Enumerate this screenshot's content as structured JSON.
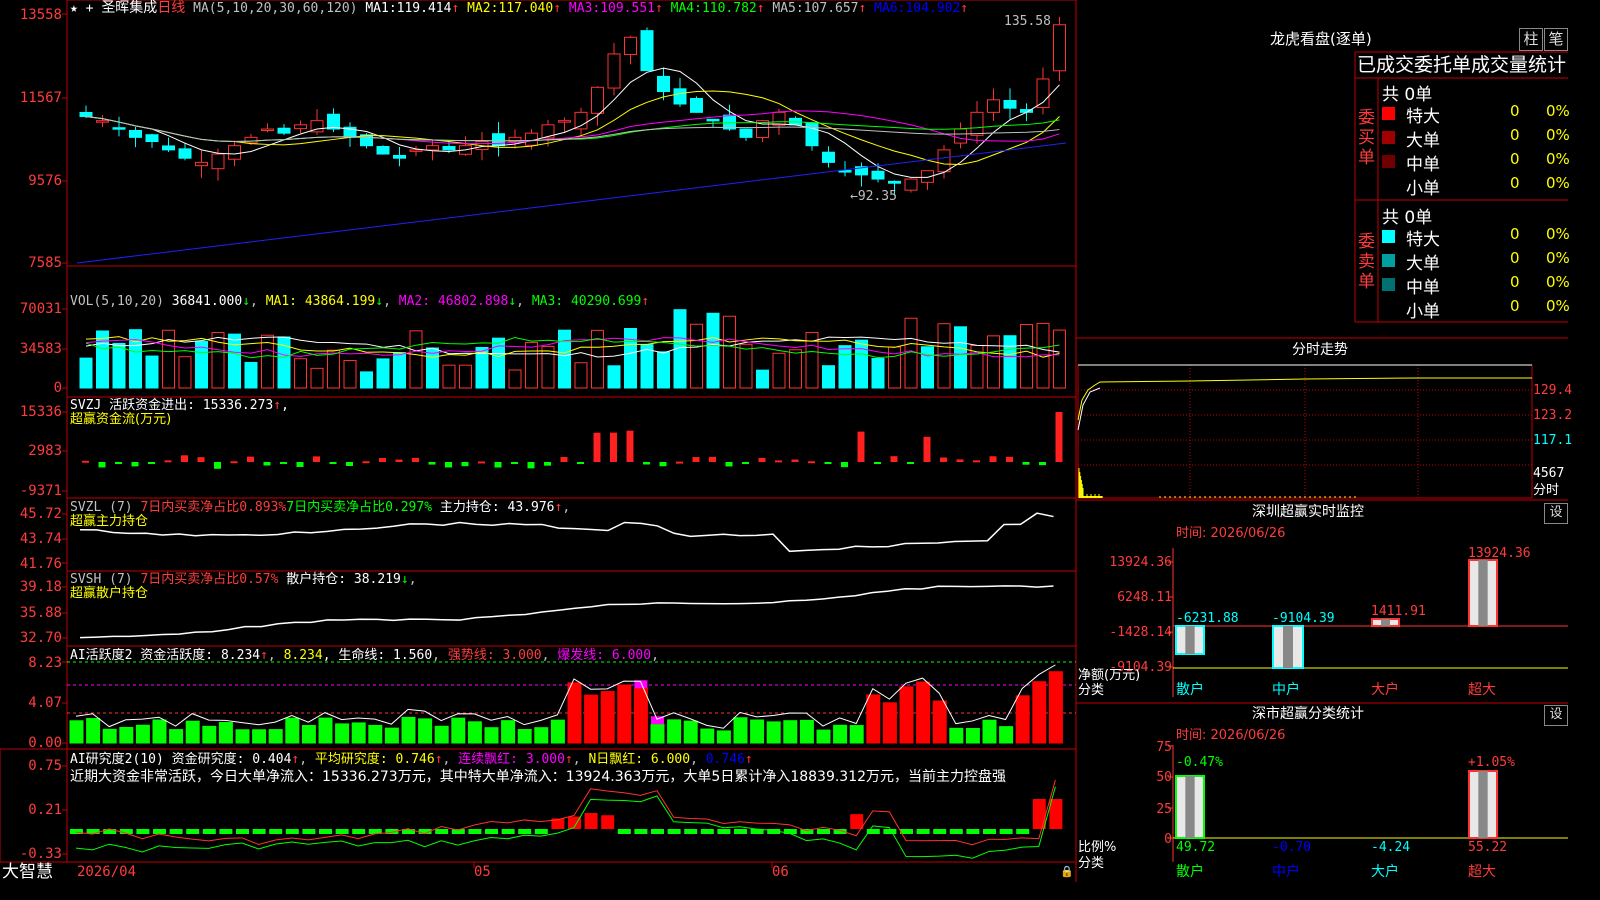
{
  "stock": {
    "name": "圣晖集成",
    "period": "日线",
    "ma_params": "MA(5,10,20,30,60,120)",
    "ma_values": [
      {
        "label": "MA1:",
        "value": "119.414",
        "color": "#ffffff"
      },
      {
        "label": "MA2:",
        "value": "117.040",
        "color": "#ffff00"
      },
      {
        "label": "MA3:",
        "value": "109.551",
        "color": "#ff00ff"
      },
      {
        "label": "MA4:",
        "value": "110.782",
        "color": "#00ff00"
      },
      {
        "label": "MA5:",
        "value": "107.657",
        "color": "#c0c0c0"
      },
      {
        "label": "MA6:",
        "value": "104.902",
        "color": "#0000ff"
      }
    ],
    "high_mark": "135.58",
    "low_mark": "92.35",
    "price_axis": [
      "13558",
      "11567",
      "9576",
      "7585"
    ]
  },
  "vol": {
    "header_params": "VOL(5,10,20)",
    "header_value": "36841.000",
    "ma1": "MA1: 43864.199",
    "ma2": "MA2: 46802.898",
    "ma3": "MA3: 40290.699",
    "axis": [
      "70031",
      "34583",
      "0"
    ]
  },
  "svzj": {
    "header": "SVZJ  活跃资金进出: 15336.273",
    "sub": "超赢资金流(万元)",
    "axis": [
      "15336",
      "2983",
      "-9371"
    ]
  },
  "svzl": {
    "p1": "SVZL (7)",
    "p2": "7日内买卖净占比0.893%",
    "p3": "7日内买卖净占比0.297%",
    "p4": "主力持仓: 43.976",
    "sub": "超赢主力持仓",
    "axis": [
      "45.72",
      "43.74",
      "41.76"
    ]
  },
  "svsh": {
    "p1": "SVSH (7)",
    "p2": "7日内买卖净占比0.57%",
    "p3": "散户持仓: 38.219",
    "sub": "超赢散户持仓",
    "axis": [
      "39.18",
      "35.88",
      "32.70"
    ]
  },
  "ai1": {
    "p1": "AI活跃度2 资金活跃度: 8.234",
    "p2": "8.234",
    "p3": "生命线: 1.560",
    "p4": "强势线: 3.000",
    "p5": "爆发线: 6.000",
    "axis": [
      "8.23",
      "4.07",
      "0.00"
    ]
  },
  "ai2": {
    "p1": "AI研究度2(10) 资金研究度: 0.404",
    "p2": "平均研究度: 0.746",
    "p3": "连续飘红: 3.000",
    "p4": "N日飘红: 6.000",
    "p5": "0.746",
    "desc": "近期大资金非常活跃，今日大单净流入：15336.273万元，其中特大单净流入：13924.363万元，大单5日累计净入18839.312万元，当前主力控盘强",
    "axis": [
      "0.75",
      "0.21",
      "-0.33"
    ]
  },
  "bottom": {
    "brand": "大智慧",
    "dates": [
      "2026/04",
      "05",
      "06"
    ]
  },
  "lhb": {
    "title": "龙虎看盘(逐单)",
    "btn1": "柱",
    "btn2": "笔",
    "subtitle": "已成交委托单成交量统计",
    "buy_side": "委买单",
    "sell_side": "委卖单",
    "buy_total": "共 0单",
    "sell_total": "共 0单",
    "buy_rows": [
      {
        "label": "特大",
        "value": "0",
        "pct": "0%",
        "color": "#ff0000"
      },
      {
        "label": "大单",
        "value": "0",
        "pct": "0%",
        "color": "#a00000"
      },
      {
        "label": "中单",
        "value": "0",
        "pct": "0%",
        "color": "#700000"
      },
      {
        "label": "小单",
        "value": "0",
        "pct": "0%",
        "color": ""
      }
    ],
    "sell_rows": [
      {
        "label": "特大",
        "value": "0",
        "pct": "0%",
        "color": "#00ffff"
      },
      {
        "label": "大单",
        "value": "0",
        "pct": "0%",
        "color": "#00a0a0"
      },
      {
        "label": "中单",
        "value": "0",
        "pct": "0%",
        "color": "#007070"
      },
      {
        "label": "小单",
        "value": "0",
        "pct": "0%",
        "color": ""
      }
    ]
  },
  "intraday": {
    "title": "分时走势",
    "axis": [
      "129.4",
      "123.2",
      "117.1",
      "4567",
      "分时"
    ]
  },
  "sz_monitor": {
    "title": "深圳超赢实时监控",
    "btn": "设",
    "time": "时间: 2026/06/26",
    "axis": [
      "13924.36",
      "6248.11",
      "-1428.14",
      "-9104.39"
    ],
    "ylabel": "净额(万元)",
    "xlabel": "分类",
    "categories": [
      "散户",
      "中户",
      "大户",
      "超大"
    ],
    "values": [
      "-6231.88",
      "-9104.39",
      "1411.91",
      "13924.36"
    ]
  },
  "sz_stats": {
    "title": "深市超赢分类统计",
    "btn": "设",
    "time": "时间: 2026/06/26",
    "axis": [
      "75",
      "50",
      "25",
      "0"
    ],
    "ylabel": "比例%",
    "xlabel": "分类",
    "categories": [
      "散户",
      "中户",
      "大户",
      "超大"
    ],
    "top_labels": [
      "-0.47%",
      "",
      "",
      "+1.05%"
    ],
    "values": [
      "49.72",
      "-0.70",
      "-4.24",
      "55.22"
    ]
  }
}
